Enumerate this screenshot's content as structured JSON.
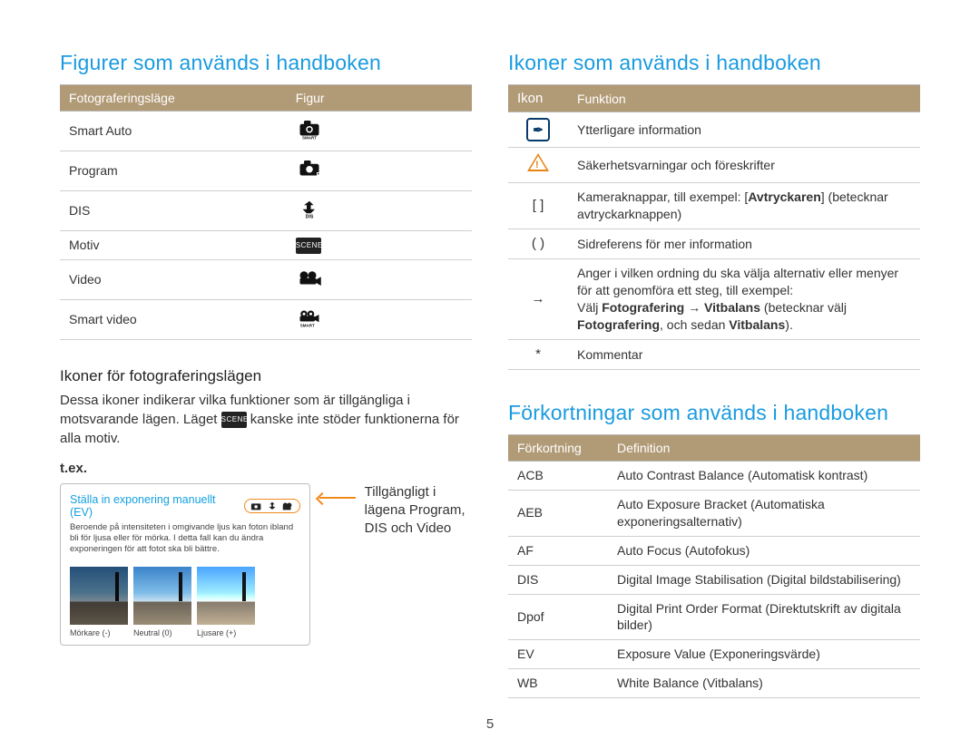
{
  "page_number": "5",
  "left": {
    "heading": "Figurer som används i handboken",
    "table1": {
      "head1": "Fotograferingsläge",
      "head2": "Figur",
      "rows": [
        {
          "mode": "Smart Auto"
        },
        {
          "mode": "Program"
        },
        {
          "mode": "DIS"
        },
        {
          "mode": "Motiv"
        },
        {
          "mode": "Video"
        },
        {
          "mode": "Smart video"
        }
      ]
    },
    "sub_heading": "Ikoner för fotograferingslägen",
    "para_before": "Dessa ikoner indikerar vilka funktioner som är tillgängliga i motsvarande lägen. Läget ",
    "para_after": " kanske inte stöder funktionerna för alla motiv.",
    "tex": "t.ex.",
    "example": {
      "title": "Ställa in exponering manuellt (EV)",
      "desc": "Beroende på intensiteten i omgivande ljus kan foton ibland bli för ljusa eller för mörka. I detta fall kan du ändra exponeringen för att fotot ska bli bättre.",
      "thumbs": [
        {
          "cap": "Mörkare (-)"
        },
        {
          "cap": "Neutral (0)"
        },
        {
          "cap": "Ljusare (+)"
        }
      ]
    },
    "note": "Tillgängligt i lägena Program, DIS och Video"
  },
  "right": {
    "heading1": "Ikoner som används i handboken",
    "icons_table": {
      "head1": "Ikon",
      "head2": "Funktion",
      "rows": [
        {
          "icon": "info",
          "text": "Ytterligare information"
        },
        {
          "icon": "warn",
          "text": "Säkerhetsvarningar och föreskrifter"
        },
        {
          "icon": "[ ]",
          "text_pre": "Kameraknappar, till exempel: [",
          "bold": "Avtryckaren",
          "text_post": "] (betecknar avtryckarknappen)"
        },
        {
          "icon": "( )",
          "text": "Sidreferens för mer information"
        },
        {
          "icon": "→",
          "multi_line1": "Anger i vilken ordning du ska välja alternativ eller menyer för att genomföra ett steg, till exempel:",
          "multi_pre": "Välj ",
          "multi_b1": "Fotografering",
          "multi_mid1": " → ",
          "multi_b2": "Vitbalans",
          "multi_mid2": " (betecknar välj ",
          "multi_b3": "Fotografering",
          "multi_mid3": ", och sedan ",
          "multi_b4": "Vitbalans",
          "multi_end": ")."
        },
        {
          "icon": "*",
          "text": "Kommentar"
        }
      ]
    },
    "heading2": "Förkortningar som används i handboken",
    "abbr_table": {
      "head1": "Förkortning",
      "head2": "Definition",
      "rows": [
        {
          "abbr": "ACB",
          "def": "Auto Contrast Balance (Automatisk kontrast)"
        },
        {
          "abbr": "AEB",
          "def": "Auto Exposure Bracket (Automatiska exponeringsalternativ)"
        },
        {
          "abbr": "AF",
          "def": "Auto Focus (Autofokus)"
        },
        {
          "abbr": "DIS",
          "def": "Digital Image Stabilisation (Digital bildstabilisering)"
        },
        {
          "abbr": "Dpof",
          "def": "Digital Print Order Format (Direktutskrift av digitala bilder)"
        },
        {
          "abbr": "EV",
          "def": "Exposure Value (Exponeringsvärde)"
        },
        {
          "abbr": "WB",
          "def": "White Balance (Vitbalans)"
        }
      ]
    }
  }
}
